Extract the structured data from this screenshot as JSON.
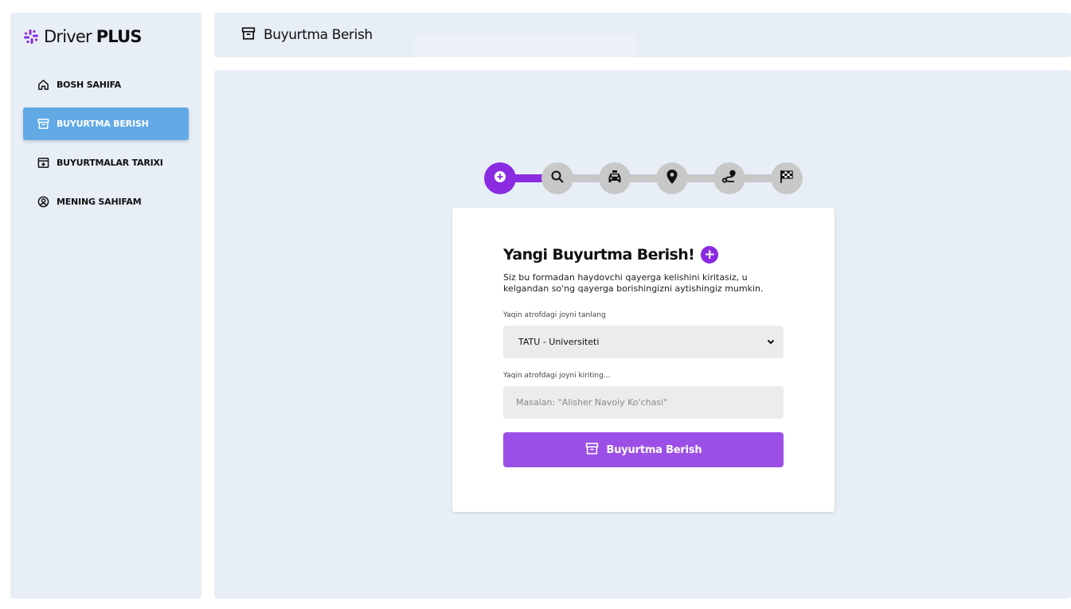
{
  "brand": {
    "name_regular": "Driver ",
    "name_bold": "PLUS",
    "icon": "slack-like-logo-icon",
    "color": "#8a2be2"
  },
  "sidebar": {
    "items": [
      {
        "label": "BOSH SAHIFA",
        "icon": "home-icon",
        "active": false
      },
      {
        "label": "BUYURTMA BERISH",
        "icon": "archive-box-icon",
        "active": true
      },
      {
        "label": "BUYURTMALAR TARIXI",
        "icon": "archive-download-icon",
        "active": false
      },
      {
        "label": "MENING SAHIFAM",
        "icon": "user-circle-icon",
        "active": false
      }
    ]
  },
  "header": {
    "title": "Buyurtma Berish",
    "icon": "archive-box-icon"
  },
  "stepper": {
    "steps": [
      {
        "icon": "plus-circle-icon",
        "active": true
      },
      {
        "icon": "search-icon",
        "active": false
      },
      {
        "icon": "taxi-icon",
        "active": false
      },
      {
        "icon": "map-pin-icon",
        "active": false
      },
      {
        "icon": "route-icon",
        "active": false
      },
      {
        "icon": "finish-flag-icon",
        "active": false
      }
    ]
  },
  "form": {
    "title": "Yangi Buyurtma Berish!",
    "description": "Siz bu formadan haydovchi qayerga kelishini kiritasiz, u kelgandan so'ng qayerga borishingizni aytishingiz mumkin.",
    "select_label": "Yaqin atrofdagi joyni tanlang",
    "select_value": "TATU - Universiteti",
    "input_label": "Yaqin atrofdagi joyni kiriting...",
    "input_placeholder": "Masalan: \"Alisher Navoiy Ko'chasi\"",
    "submit_label": "Buyurtma Berish"
  },
  "colors": {
    "accent": "#8a2be2",
    "button": "#9c4fe6",
    "nav_active": "#62aae6",
    "panel_bg": "#e7eef6"
  }
}
